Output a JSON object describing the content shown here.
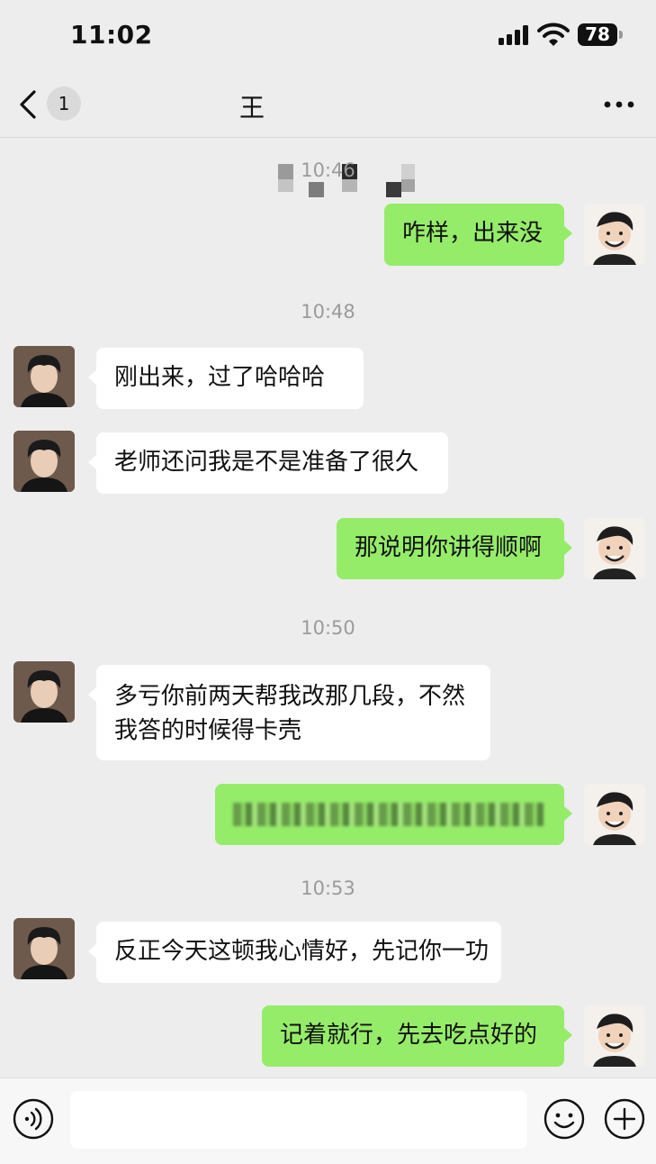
{
  "status_bar": {
    "time": "11:02",
    "battery": "78"
  },
  "header": {
    "back_count": "1",
    "title_visible": "王"
  },
  "messages": [
    {
      "type": "timestamp",
      "text": "10:46"
    },
    {
      "type": "sent",
      "text": "咋样，出来没"
    },
    {
      "type": "timestamp",
      "text": "10:48"
    },
    {
      "type": "received",
      "text": "刚出来，过了哈哈哈"
    },
    {
      "type": "received",
      "text": "老师还问我是不是准备了很久"
    },
    {
      "type": "sent",
      "text": "那说明你讲得顺啊"
    },
    {
      "type": "timestamp",
      "text": "10:50"
    },
    {
      "type": "received",
      "text": "多亏你前两天帮我改那几段，不然我答的时候得卡壳"
    },
    {
      "type": "sent",
      "text": "",
      "obscured": true
    },
    {
      "type": "timestamp",
      "text": "10:53"
    },
    {
      "type": "received",
      "text": "反正今天这顿我心情好，先记你一功"
    },
    {
      "type": "sent",
      "text": "记着就行，先去吃点好的"
    }
  ],
  "input_bar": {
    "value": "",
    "icons": [
      "voice-icon",
      "emoji-icon",
      "plus-icon"
    ]
  },
  "colors": {
    "sent_bubble": "#95ec69",
    "received_bubble": "#ffffff",
    "background": "#ededed"
  }
}
